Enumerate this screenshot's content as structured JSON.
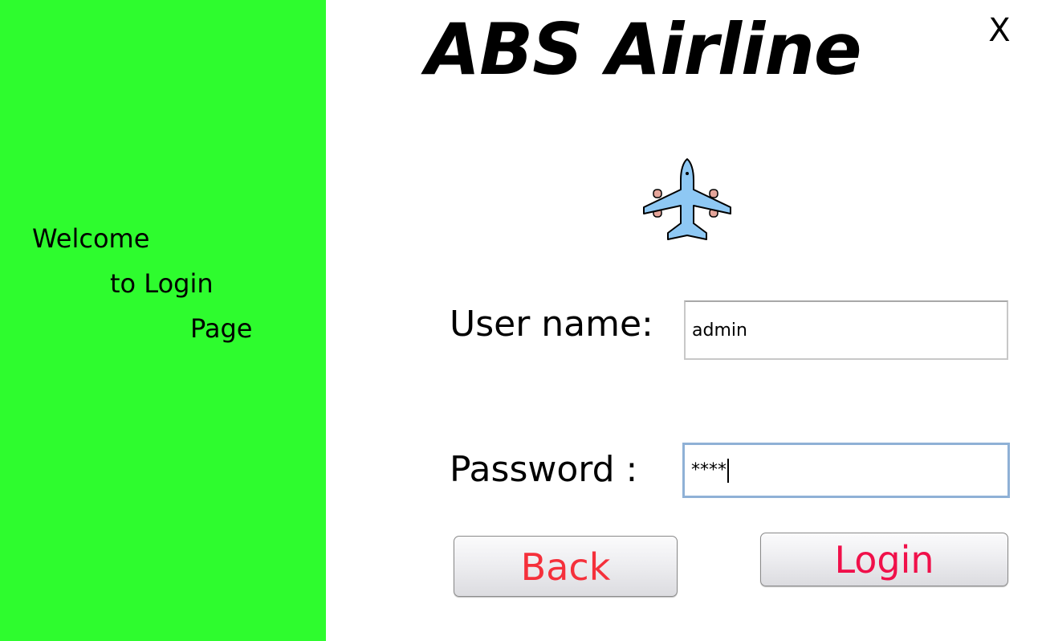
{
  "colors": {
    "side_panel": "#2efc2e",
    "button_text_back": "#f5303b",
    "button_text_login": "#f0104a",
    "plane_body": "#8ec8f4",
    "plane_engine": "#e5a59a"
  },
  "side_panel": {
    "welcome_line1": "Welcome",
    "welcome_line2": "to Login",
    "welcome_line3": "Page"
  },
  "header": {
    "title": "ABS Airline",
    "close_label": "X"
  },
  "logo": {
    "icon": "airplane-icon"
  },
  "form": {
    "username_label": "User name:",
    "username_value": "admin",
    "password_label": "Password :",
    "password_value": "****"
  },
  "buttons": {
    "back_label": "Back",
    "login_label": "Login"
  }
}
